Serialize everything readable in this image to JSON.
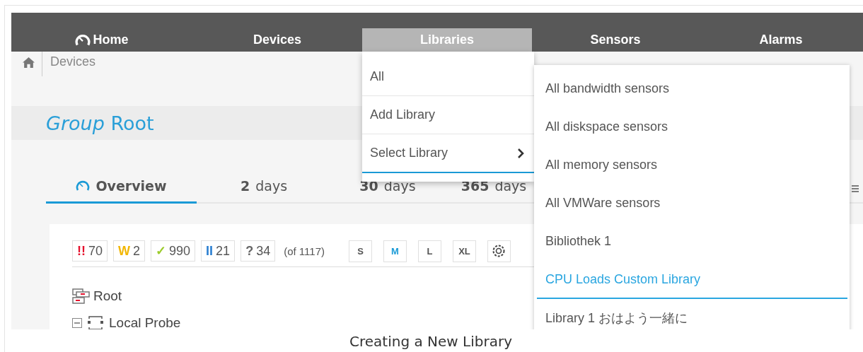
{
  "nav": [
    {
      "label": "Home",
      "kind": "gauge",
      "selected": false
    },
    {
      "label": "Devices",
      "kind": "plain",
      "selected": false
    },
    {
      "label": "Libraries",
      "kind": "plain",
      "selected": true
    },
    {
      "label": "Sensors",
      "kind": "plain",
      "selected": false
    },
    {
      "label": "Alarms",
      "kind": "plain",
      "selected": false
    }
  ],
  "breadcrumb": [
    "Devices"
  ],
  "title": {
    "prefix": "Group",
    "name": "Root"
  },
  "tabs": [
    {
      "label": "Overview",
      "kind": "gauge",
      "selected": true
    },
    {
      "number": "2",
      "label": "days",
      "kind": "period",
      "selected": false
    },
    {
      "number": "30",
      "label": "days",
      "kind": "period",
      "selected": false
    },
    {
      "number": "365",
      "label": "days",
      "kind": "period",
      "selected": false
    }
  ],
  "status_counts": [
    {
      "symbol": "!!",
      "count": "70",
      "color": "#e5112d"
    },
    {
      "symbol": "W",
      "count": "2",
      "color": "#f2b705"
    },
    {
      "symbol": "✓",
      "count": "990",
      "color": "#9ccc2c"
    },
    {
      "symbol": "II",
      "count": "21",
      "color": "#2b7fd1"
    },
    {
      "symbol": "?",
      "count": "34",
      "color": "#666666"
    }
  ],
  "total": "(of 1117)",
  "sizes": [
    {
      "label": "S",
      "selected": false
    },
    {
      "label": "M",
      "selected": true
    },
    {
      "label": "L",
      "selected": false
    },
    {
      "label": "XL",
      "selected": false
    }
  ],
  "tree": [
    {
      "label": "Root",
      "kind": "group",
      "children": [
        {
          "label": "Local Probe",
          "kind": "probe",
          "expanded": true
        }
      ]
    }
  ],
  "libraries_menu": [
    {
      "label": "All",
      "has_submenu": false,
      "selected": false
    },
    {
      "label": "Add Library",
      "has_submenu": false,
      "selected": false
    },
    {
      "label": "Select Library",
      "has_submenu": true,
      "selected": true
    }
  ],
  "library_submenu": [
    {
      "label": "All bandwidth sensors",
      "selected": false
    },
    {
      "label": "All diskspace sensors",
      "selected": false
    },
    {
      "label": "All memory sensors",
      "selected": false
    },
    {
      "label": "All VMWare sensors",
      "selected": false
    },
    {
      "label": "Bibliothek 1",
      "selected": false
    },
    {
      "label": "CPU Loads Custom Library",
      "selected": true
    },
    {
      "label": "Library 1 おはよう一緒に",
      "selected": false
    }
  ],
  "caption": "Creating a New Library"
}
